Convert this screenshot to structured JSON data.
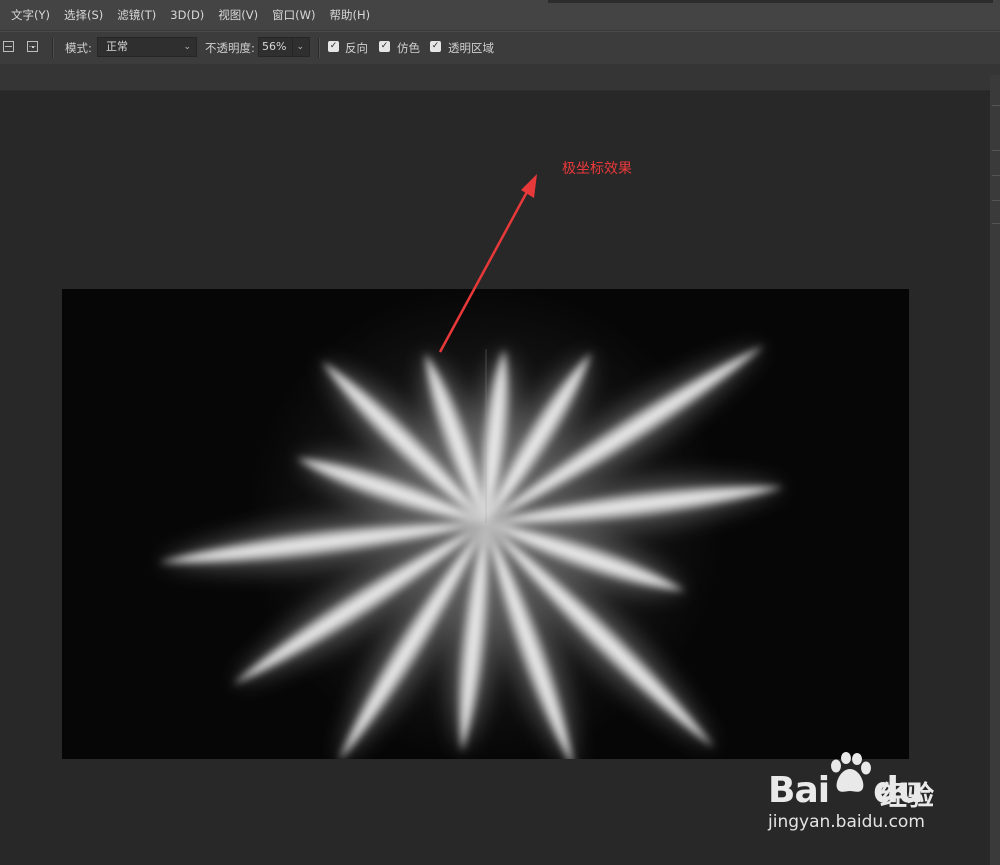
{
  "menu": [
    "文字(Y)",
    "选择(S)",
    "滤镜(T)",
    "3D(D)",
    "视图(V)",
    "窗口(W)",
    "帮助(H)"
  ],
  "options": {
    "mode_label": "模式:",
    "mode_value": "正常",
    "opacity_label": "不透明度:",
    "opacity_value": "56%",
    "checkboxes": [
      {
        "label": "反向",
        "checked": true
      },
      {
        "label": "仿色",
        "checked": true
      },
      {
        "label": "透明区域",
        "checked": true
      }
    ]
  },
  "annotation": {
    "text": "极坐标效果",
    "color": "#e8393a"
  },
  "watermark": {
    "brand": "Bai du 经验",
    "url": "jingyan.baidu.com"
  },
  "colors": {
    "menubar": "#444444",
    "options_bar": "#3c3c3c",
    "workspace": "#282828",
    "canvas": "#060606"
  }
}
